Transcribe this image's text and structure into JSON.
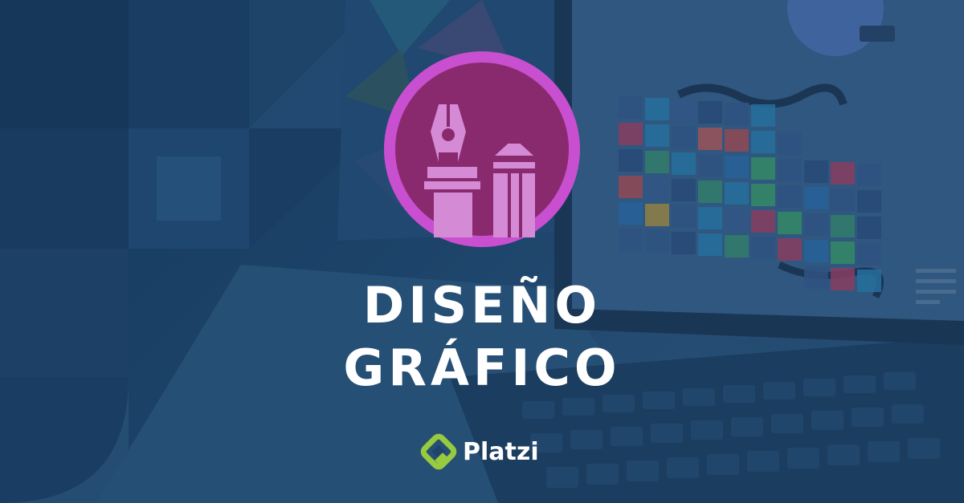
{
  "hero": {
    "title_line1": "DISEÑO",
    "title_line2": "GRÁFICO"
  },
  "brand": {
    "name": "Platzi"
  },
  "colors": {
    "background_navy": "#1d4266",
    "badge_ring": "#c84fd0",
    "badge_fill": "#8a2a6e",
    "icon_fill": "#d58ad6",
    "brand_green": "#98ca3f",
    "title_text": "#ffffff"
  },
  "icons": {
    "badge": "pen-nib-and-pencil-icon",
    "brand_logo": "platzi-logo-icon"
  }
}
